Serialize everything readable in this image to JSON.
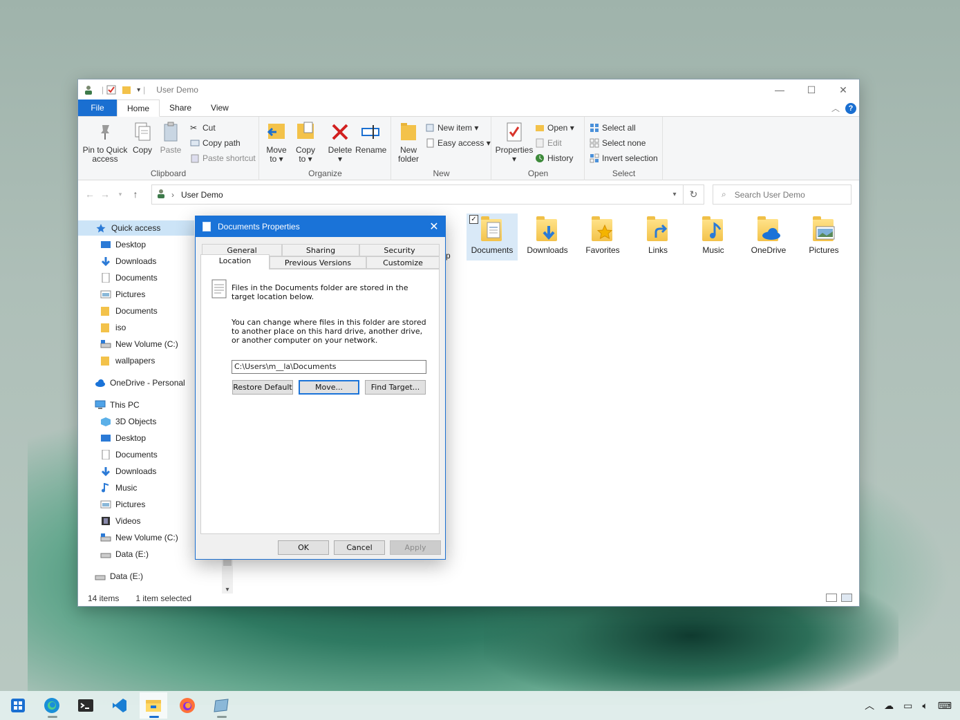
{
  "window": {
    "title": "User Demo",
    "tabs": {
      "file": "File",
      "home": "Home",
      "share": "Share",
      "view": "View"
    }
  },
  "ribbon": {
    "clipboard": {
      "label": "Clipboard",
      "pin": [
        "Pin to Quick",
        "access"
      ],
      "copy": "Copy",
      "paste": "Paste",
      "cut": "Cut",
      "copy_path": "Copy path",
      "paste_shortcut": "Paste shortcut"
    },
    "organize": {
      "label": "Organize",
      "move_to": [
        "Move",
        "to ▾"
      ],
      "copy_to": [
        "Copy",
        "to ▾"
      ],
      "delete": [
        "Delete",
        "▾"
      ],
      "rename": "Rename"
    },
    "new": {
      "label": "New",
      "new_folder": [
        "New",
        "folder"
      ],
      "new_item": "New item ▾",
      "easy_access": "Easy access ▾"
    },
    "open": {
      "label": "Open",
      "properties": [
        "Properties",
        "▾"
      ],
      "open": "Open ▾",
      "edit": "Edit",
      "history": "History"
    },
    "select": {
      "label": "Select",
      "select_all": "Select all",
      "select_none": "Select none",
      "invert": "Invert selection"
    }
  },
  "address": {
    "crumb": "User Demo",
    "search_placeholder": "Search User Demo"
  },
  "nav": {
    "quick_access": "Quick access",
    "quick_items": [
      "Desktop",
      "Downloads",
      "Documents",
      "Pictures",
      "Documents",
      "iso",
      "New Volume (C:)",
      "wallpapers"
    ],
    "onedrive": "OneDrive - Personal",
    "this_pc": "This PC",
    "pc_items": [
      "3D Objects",
      "Desktop",
      "Documents",
      "Downloads",
      "Music",
      "Pictures",
      "Videos",
      "New Volume (C:)",
      "Data (E:)"
    ],
    "data_e": "Data (E:)"
  },
  "content": {
    "partial_label": "p",
    "folders": [
      "Documents",
      "Downloads",
      "Favorites",
      "Links",
      "Music",
      "OneDrive",
      "Pictures"
    ]
  },
  "status": {
    "items": "14 items",
    "selected": "1 item selected"
  },
  "dialog": {
    "title": "Documents Properties",
    "tabs_row1": [
      "General",
      "Sharing",
      "Security"
    ],
    "tabs_row2": [
      "Location",
      "Previous Versions",
      "Customize"
    ],
    "text1": "Files in the Documents folder are stored in the target location below.",
    "text2": "You can change where files in this folder are stored to another place on this hard drive, another drive, or another computer on your network.",
    "path": "C:\\Users\\m__la\\Documents",
    "restore": "Restore Default",
    "move": "Move...",
    "find": "Find Target...",
    "ok": "OK",
    "cancel": "Cancel",
    "apply": "Apply"
  },
  "colors": {
    "accent": "#1a6fd1",
    "folder": "#f3c24a",
    "selection": "#cce4f7"
  }
}
